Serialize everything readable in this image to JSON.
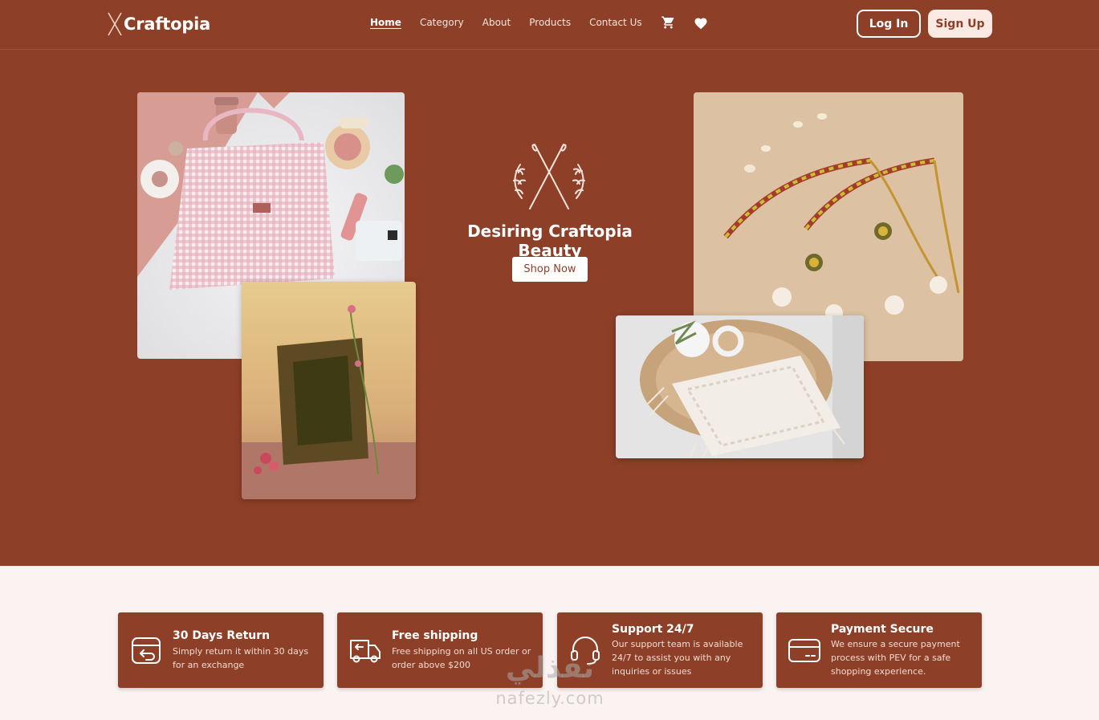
{
  "brand": {
    "name": "Craftopia"
  },
  "nav": {
    "items": [
      {
        "label": "Home",
        "active": true
      },
      {
        "label": "Category"
      },
      {
        "label": "About"
      },
      {
        "label": "Products"
      },
      {
        "label": "Contact Us"
      }
    ],
    "icons": [
      "cart-icon",
      "heart-icon"
    ],
    "login_label": "Log In",
    "signup_label": "Sign Up"
  },
  "hero": {
    "tagline": "Desiring Craftopia Beauty",
    "cta_label": "Shop Now",
    "images": [
      "handbag-flatlay-photo",
      "ornate-frame-photo",
      "beaded-bracelets-photo",
      "macrame-placemat-photo"
    ]
  },
  "features": [
    {
      "icon": "return-box-icon",
      "title": "30 Days Return",
      "description": "Simply return it within 30 days for an exchange"
    },
    {
      "icon": "delivery-truck-icon",
      "title": "Free shipping",
      "description": "Free shipping on all US order or order above $200"
    },
    {
      "icon": "headset-icon",
      "title": "Support 24/7",
      "description": "Our support team is available 24/7 to assist you with any inquiries or issues"
    },
    {
      "icon": "credit-card-icon",
      "title": "Payment Secure",
      "description": "We ensure a secure payment process with PEV for a safe shopping experience."
    }
  ],
  "watermark": {
    "arabic": "نفذلي",
    "latin": "nafezly.com"
  },
  "colors": {
    "primary": "#8e3f27",
    "background": "#fbf3f1",
    "accent_light": "#fbe9e4"
  }
}
